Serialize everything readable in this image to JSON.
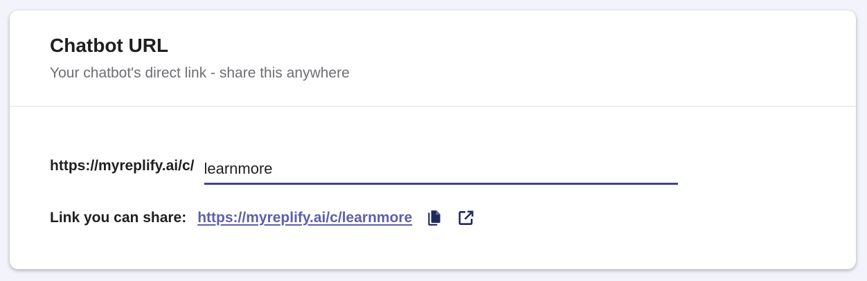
{
  "header": {
    "title": "Chatbot URL",
    "subtitle": "Your chatbot's direct link - share this anywhere"
  },
  "url_editor": {
    "prefix": "https://myreplify.ai/c/",
    "slug_value": "learnmore"
  },
  "share": {
    "label": "Link you can share:",
    "link_text": "https://myreplify.ai/c/learnmore",
    "icons": [
      "copy-icon",
      "open-external-icon"
    ]
  },
  "colors": {
    "accent": "#3f4190",
    "link": "#5c5fa8",
    "icon": "#1e2a5a",
    "page_background": "#f3f4fb"
  }
}
